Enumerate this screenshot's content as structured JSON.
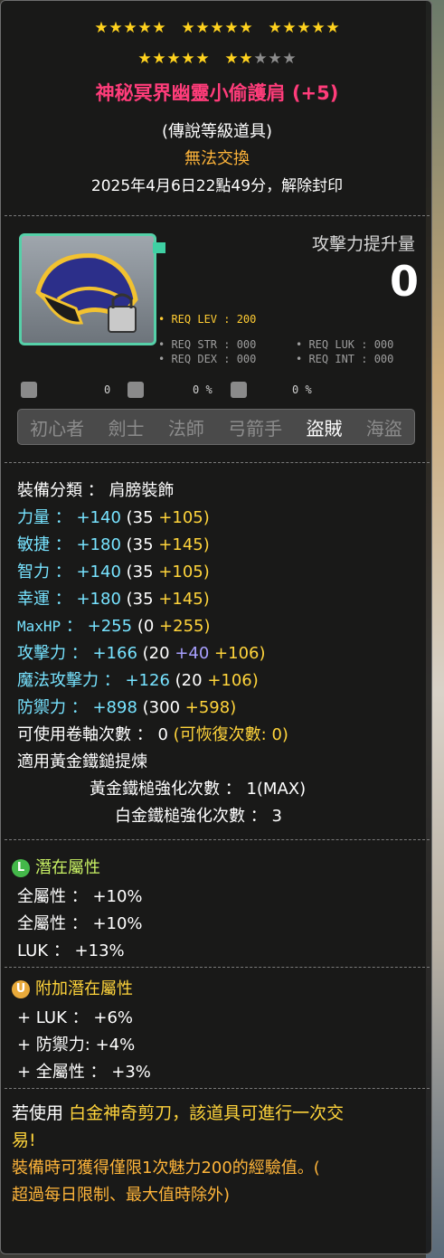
{
  "stars": {
    "row1_filled": 15,
    "row2_filled": 8,
    "row2_total": 10
  },
  "item": {
    "title": "神秘冥界幽靈小偷護肩 (+5)",
    "grade": "(傳說等級道具)",
    "trade": "無法交換",
    "unseal": "2025年4月6日22點49分，解除封印"
  },
  "reqs": {
    "lev": "• REQ LEV : 200",
    "str": "• REQ STR : 000",
    "luk": "• REQ LUK : 000",
    "dex": "• REQ DEX : 000",
    "int": "• REQ INT : 000"
  },
  "atk_boost": {
    "label": "攻擊力提升量",
    "value": "0"
  },
  "icon_counts": {
    "a": "0",
    "b": "0 %",
    "c": "0 %"
  },
  "jobs": [
    "初心者",
    "劍士",
    "法師",
    "弓箭手",
    "盜賊",
    "海盜"
  ],
  "stats": {
    "category": "裝備分類 ： 肩膀裝飾",
    "str": {
      "label": "力量",
      "total": "+140",
      "base": "(35",
      "bonus": "+105)"
    },
    "dex": {
      "label": "敏捷",
      "total": "+180",
      "base": "(35",
      "bonus": "+145)"
    },
    "int": {
      "label": "智力",
      "total": "+140",
      "base": "(35",
      "bonus": "+105)"
    },
    "luk": {
      "label": "幸運",
      "total": "+180",
      "base": "(35",
      "bonus": "+145)"
    },
    "hp": {
      "label": "MaxHP",
      "total": "+255",
      "base": "(0",
      "bonus": "+255)"
    },
    "atk": {
      "label": "攻擊力",
      "total": "+166",
      "base": "(20",
      "bonus1": "+40",
      "bonus2": "+106)"
    },
    "matk": {
      "label": "魔法攻擊力",
      "total": "+126",
      "base": "(20",
      "bonus": "+106)"
    },
    "def": {
      "label": "防禦力",
      "total": "+898",
      "base": "(300",
      "bonus": "+598)"
    },
    "scroll": "可使用卷軸次數 ： 0",
    "scroll_restore": "(可恢復次數: 0)",
    "golden_hammer": "適用黃金鐵鎚提煉",
    "golden_count": "黃金鐵槌強化次數 ： 1(MAX)",
    "platinum_count": "白金鐵槌強化次數 ： 3"
  },
  "potential": {
    "title": "潛在屬性",
    "lines": [
      "全屬性 ： +10%",
      "全屬性 ： +10%",
      "LUK ： +13%"
    ]
  },
  "additional": {
    "title": "附加潛在屬性",
    "lines": [
      "+ LUK ： +6%",
      "+ 防禦力: +4%",
      "+ 全屬性 ： +3%"
    ]
  },
  "footer": {
    "line1_a": "若使用",
    "line1_b": "白金神奇剪刀，",
    "line1_c": "該道具可進行一次交",
    "line2": "易!",
    "line3": "裝備時可獲得僅限1次魅力200的經驗值。(",
    "line4": "超過每日限制、最大值時除外)"
  },
  "colors": {
    "title": "#ff3c7a",
    "accent": "#ffd43b",
    "stat": "#77e3ff"
  }
}
